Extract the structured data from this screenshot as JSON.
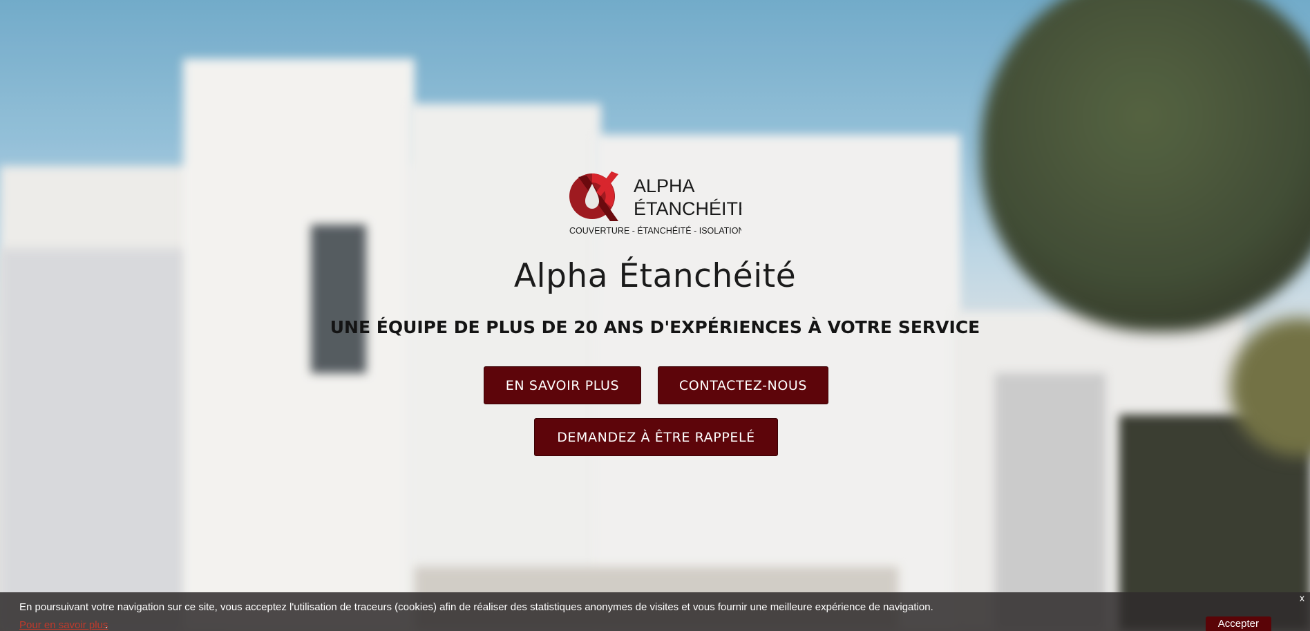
{
  "logo": {
    "name_line1": "ALPHA",
    "name_line2": "ÉTANCHÉITÉ",
    "subtitle": "COUVERTURE - ÉTANCHÉITÉ - ISOLATION",
    "colors": {
      "primary": "#b01c22",
      "dark": "#6b0a0e",
      "text": "#1a1a1a"
    }
  },
  "hero": {
    "title": "Alpha Étanchéité",
    "tagline": "UNE ÉQUIPE DE PLUS DE 20 ANS D'EXPÉRIENCES À VOTRE SERVICE",
    "buttons": {
      "learn_more": "EN SAVOIR PLUS",
      "contact": "CONTACTEZ-NOUS",
      "callback": "DEMANDEZ À ÊTRE RAPPELÉ"
    },
    "button_color": "#5d050a"
  },
  "cookie_banner": {
    "message": "En poursuivant votre navigation sur ce site, vous acceptez l'utilisation de traceurs (cookies) afin de réaliser des statistiques anonymes de visites et vous fournir une meilleure expérience de navigation.",
    "learn_more_link": "Pour en savoir plus",
    "trailing": ".",
    "accept_label": "Accepter",
    "close_label": "x"
  }
}
